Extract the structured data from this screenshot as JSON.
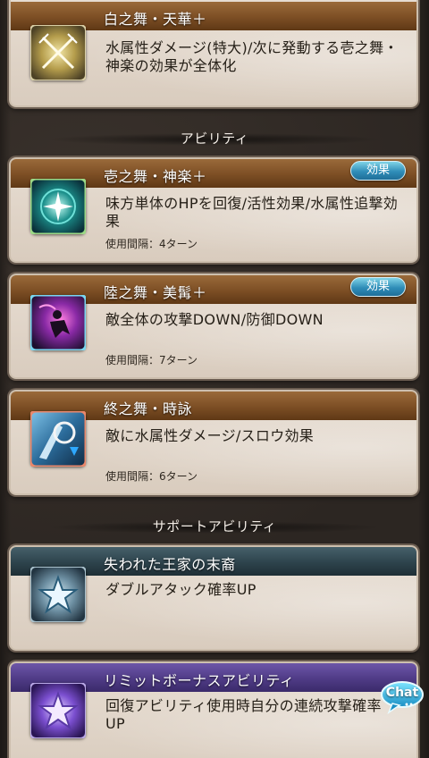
{
  "sections": {
    "ability": "アビリティ",
    "support": "サポートアビリティ"
  },
  "badge_label": "効果",
  "interval_label": "使用間隔：",
  "cards": [
    {
      "title": "白之舞・天華＋",
      "desc": "水属性ダメージ(特大)/次に発動する壱之舞・神楽の効果が全体化",
      "icon": "crossed-swords-icon",
      "header_color": "#7c4e24"
    },
    {
      "title": "壱之舞・神楽＋",
      "desc": "味方単体のHPを回復/活性効果/水属性追撃効果",
      "interval": "使用間隔：4ターン",
      "icon": "sparkle-heal-icon",
      "header_color": "#7c4e24"
    },
    {
      "title": "陸之舞・美髯＋",
      "desc": "敵全体の攻撃DOWN/防御DOWN",
      "interval": "使用間隔：7ターン",
      "icon": "debuff-icon",
      "header_color": "#7c4e24"
    },
    {
      "title": "終之舞・時詠",
      "desc": "敵に水属性ダメージ/スロウ効果",
      "interval": "使用間隔：6ターン",
      "icon": "slow-icon",
      "header_color": "#7c4e24"
    },
    {
      "title": "失われた王家の末裔",
      "desc": "ダブルアタック確率UP",
      "icon": "star-blue-icon",
      "header_color": "#2d434c"
    },
    {
      "title": "リミットボーナスアビリティ",
      "desc": "回復アビリティ使用時自分の連続攻撃確率UP",
      "icon": "star-purple-icon",
      "header_color": "#4f3b86"
    }
  ],
  "chat_label": "Chat",
  "colors": {
    "badge": "#2f8db8",
    "card_bg": "#e2d7cb",
    "page_bg": "#2e2824"
  }
}
